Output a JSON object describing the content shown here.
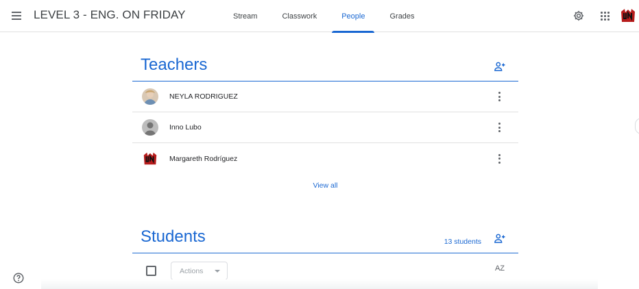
{
  "header": {
    "class_title": "LEVEL 3 - ENG. ON FRIDAY",
    "tabs": [
      {
        "label": "Stream",
        "active": false
      },
      {
        "label": "Classwork",
        "active": false
      },
      {
        "label": "People",
        "active": true
      },
      {
        "label": "Grades",
        "active": false
      }
    ],
    "icons": [
      "menu-icon",
      "settings-gear-icon",
      "apps-grid-icon",
      "account-logo-icon"
    ],
    "accent_color": "#1967d2"
  },
  "teachers": {
    "title": "Teachers",
    "list": [
      {
        "name": "NEYLA RODRIGUEZ",
        "avatar": "photo"
      },
      {
        "name": "Inno Lubo",
        "avatar": "default-person"
      },
      {
        "name": "Margareth Rodríguez",
        "avatar": "un-logo"
      }
    ],
    "view_all": "View all"
  },
  "students": {
    "title": "Students",
    "count_label": "13 students",
    "actions_label": "Actions",
    "sort_label": "AZ"
  }
}
